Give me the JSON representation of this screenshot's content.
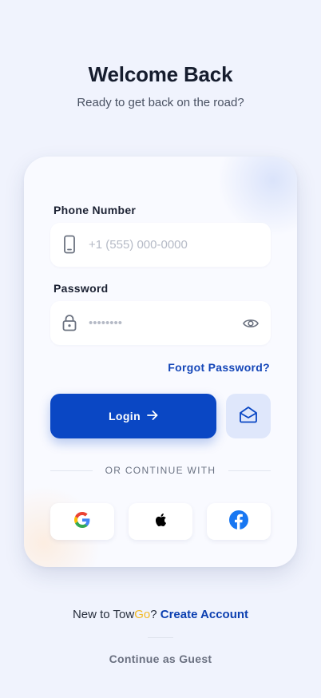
{
  "header": {
    "title": "Welcome Back",
    "subtitle": "Ready to get back on the road?"
  },
  "form": {
    "phone_label": "Phone Number",
    "phone_placeholder": "+1 (555) 000-0000",
    "password_label": "Password",
    "password_placeholder": "••••••••",
    "forgot_label": "Forgot Password?",
    "login_label": "Login",
    "divider_text": "OR CONTINUE WITH"
  },
  "social": {
    "google": "google-icon",
    "apple": "apple-icon",
    "facebook": "facebook-icon"
  },
  "footer": {
    "signup_prefix": "New to Tow",
    "brand_go": "Go",
    "signup_qmark": "? ",
    "create_label": "Create Account",
    "guest_label": "Continue as Guest"
  },
  "colors": {
    "primary": "#0a47c4",
    "accent_yellow": "#f2b922",
    "link": "#1446b8",
    "background": "#f0f3fd"
  }
}
